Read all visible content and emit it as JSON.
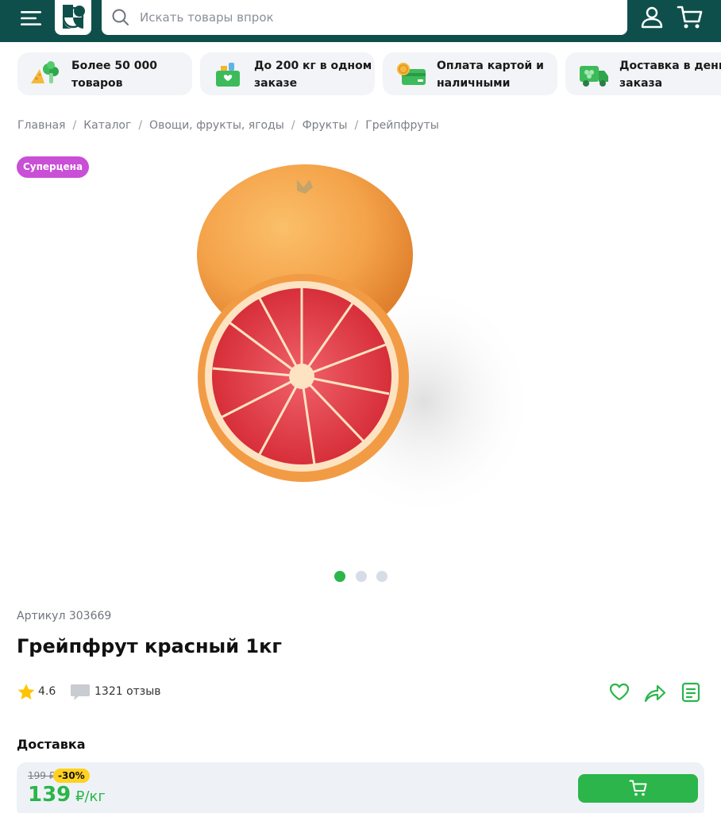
{
  "header": {
    "search_placeholder": "Искать товары впрок"
  },
  "features": [
    {
      "label": "Более 50 000 товаров",
      "icon": "cheese-broccoli-icon"
    },
    {
      "label": "До 200 кг в одном заказе",
      "icon": "grocery-bag-icon"
    },
    {
      "label": "Оплата картой и наличными",
      "icon": "card-coin-icon"
    },
    {
      "label": "Доставка в день заказа",
      "icon": "delivery-truck-icon"
    }
  ],
  "breadcrumb": [
    "Главная",
    "Каталог",
    "Овощи, фрукты, ягоды",
    "Фрукты",
    "Грейпфруты"
  ],
  "product": {
    "badge": "Суперцена",
    "sku": "Артикул 303669",
    "title": "Грейпфрут красный 1кг",
    "rating": "4.6",
    "reviews": "1321 отзыв",
    "carousel_active": 1,
    "carousel_total": 3
  },
  "delivery": {
    "title": "Доставка",
    "old_price": "199 ₽",
    "discount": "-30%",
    "price": "139",
    "price_unit": " ₽/кг"
  },
  "colors": {
    "header_bg": "#0f4f4b",
    "accent_green": "#2bb54a",
    "badge_purple": "#c94fd6",
    "discount_yellow": "#ffd21f"
  }
}
